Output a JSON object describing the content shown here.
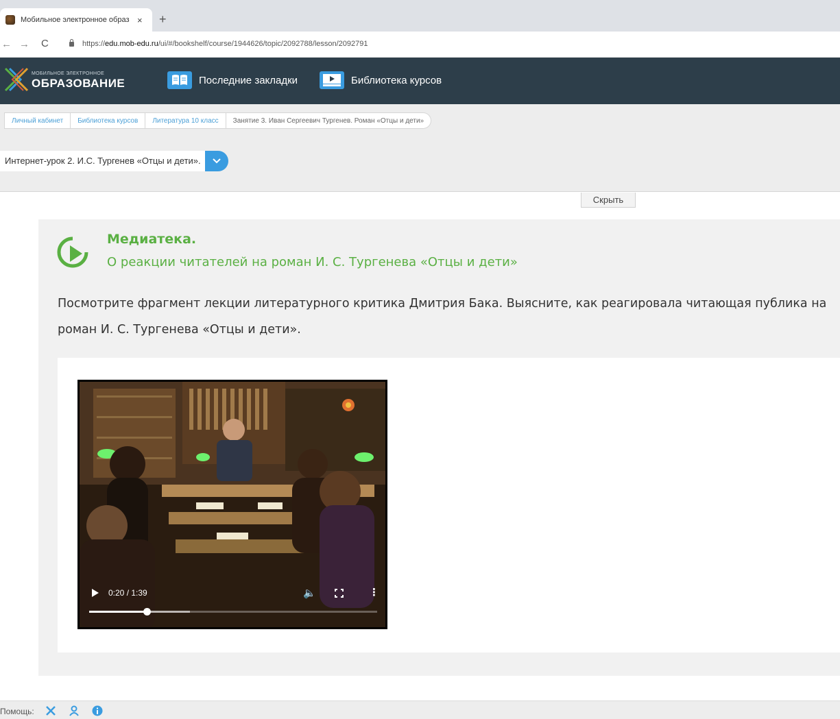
{
  "browser": {
    "tab_title": "Мобильное электронное образ",
    "tab_close": "×",
    "new_tab": "+",
    "nav_back": "←",
    "nav_forward": "→",
    "nav_reload": "C",
    "url_scheme": "https://",
    "url_host": "edu.mob-edu.ru",
    "url_path": "/ui/#/bookshelf/course/1944626/topic/2092788/lesson/2092791"
  },
  "header": {
    "logo_small": "МОБИЛЬНОЕ ЭЛЕКТРОННОЕ",
    "logo_big": "ОБРАЗОВАНИЕ",
    "nav_bookmarks": "Последние закладки",
    "nav_library": "Библиотека курсов",
    "accent": "#3a9ce0"
  },
  "breadcrumb": [
    "Личный кабинет",
    "Библиотека курсов",
    "Литература 10 класс",
    "Занятие 3. Иван Сергеевич Тургенев. Роман «Отцы и дети»"
  ],
  "lesson_select": {
    "value": "Интернет-урок 2. И.С. Тургенев «Отцы и дети»."
  },
  "hide_button": "Скрыть",
  "media": {
    "title": "Медиатека.",
    "subtitle": "О реакции читателей на роман И. С. Тургенева «Отцы и дети»",
    "task": "Посмотрите фрагмент лекции литературного критика Дмитрия Бака. Выясните, как реагировала читающая публика на роман И. С. Тургенева «Отцы и дети».",
    "accent": "#5ab043"
  },
  "video": {
    "time": "0:20 / 1:39",
    "progress": 0.2,
    "buffered": 0.35
  },
  "footer": {
    "help_label": "Помощь:",
    "icons": [
      "tools-icon",
      "user-icon",
      "info-icon"
    ]
  }
}
